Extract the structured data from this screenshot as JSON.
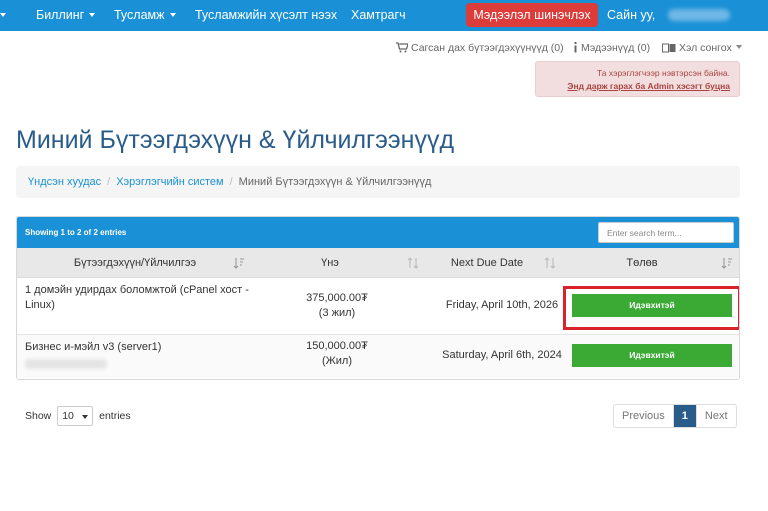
{
  "navbar": {
    "items": [
      {
        "label": "Биллинг",
        "dropdown": true
      },
      {
        "label": "Тусламж",
        "dropdown": true
      },
      {
        "label": "Тусламжийн хүсэлт нээх",
        "dropdown": false
      },
      {
        "label": "Хамтрагч",
        "dropdown": false
      }
    ],
    "update_button": "Мэдээлэл шинэчлэх",
    "greeting": "Сайн уу,"
  },
  "utility": {
    "cart": "Сагсан дах бүтээгдэхүүнүүд (0)",
    "notifications": "Мэдээнүүд (0)",
    "language": "Хэл сонгох"
  },
  "alert": {
    "message": "Та хэрэглэгчээр нэвтэрсэн байна.",
    "link": "Энд дарж гарах ба Admin хэсэгт буцна"
  },
  "page": {
    "title": "Миний Бүтээгдэхүүн & Үйлчилгээнүүд"
  },
  "breadcrumb": [
    {
      "label": "Үндсэн хуудас",
      "link": true
    },
    {
      "label": "Хэрэглэгчийн систем",
      "link": true
    },
    {
      "label": "Миний Бүтээгдэхүүн & Үйлчилгээнүүд",
      "link": false
    }
  ],
  "table": {
    "showing": "Showing 1 to 2 of 2 entries",
    "search_placeholder": "Enter search term...",
    "columns": [
      "Бүтээгдэхүүн/Үйлчилгээ",
      "Үнэ",
      "Next Due Date",
      "Төлөв"
    ],
    "rows": [
      {
        "product": "1 домэйн удирдах боломжтой (cPanel хост - Linux)",
        "price": "375,000.00₮",
        "cycle": "(3 жил)",
        "due": "Friday, April 10th, 2026",
        "status": "Идэвхитэй"
      },
      {
        "product": "Бизнес и-мэйл v3 (server1)",
        "price": "150,000.00₮",
        "cycle": "(Жил)",
        "due": "Saturday, April 6th, 2024",
        "status": "Идэвхитэй"
      }
    ]
  },
  "footer": {
    "show_label": "Show",
    "entries_value": "10",
    "entries_label": "entries",
    "pagination": {
      "previous": "Previous",
      "current": "1",
      "next": "Next"
    }
  },
  "colors": {
    "navbar": "#1a91d6",
    "update_button": "#dc3c3a",
    "status_active": "#3aaa35",
    "title": "#2a5c8a",
    "highlight": "#d9222a"
  }
}
